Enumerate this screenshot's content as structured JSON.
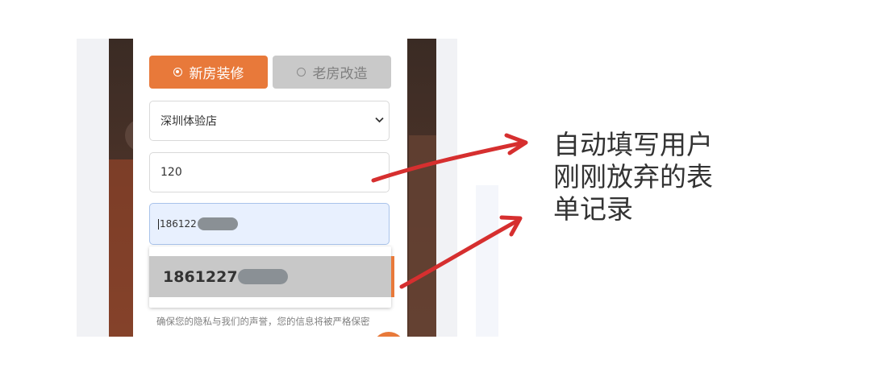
{
  "form": {
    "tabs": [
      {
        "label": "新房装修",
        "selected": true
      },
      {
        "label": "老房改造",
        "selected": false
      }
    ],
    "store_select": {
      "value": "深圳体验店"
    },
    "area_input": {
      "value": "120"
    },
    "phone_input": {
      "value": "186122"
    },
    "autocomplete": {
      "suggestion": "1861227"
    },
    "privacy_note": "确保您的隐私与我们的声誉，您的信息将被严格保密"
  },
  "annotation": {
    "lines": [
      "自动填写用户",
      "刚刚放弃的表",
      "单记录"
    ]
  },
  "colors": {
    "accent": "#e8793a",
    "arrow": "#d62f2f",
    "autofill_bg": "#e8f0fe"
  },
  "icons": [
    "radio-selected-icon",
    "radio-unselected-icon",
    "chevron-down-icon"
  ]
}
